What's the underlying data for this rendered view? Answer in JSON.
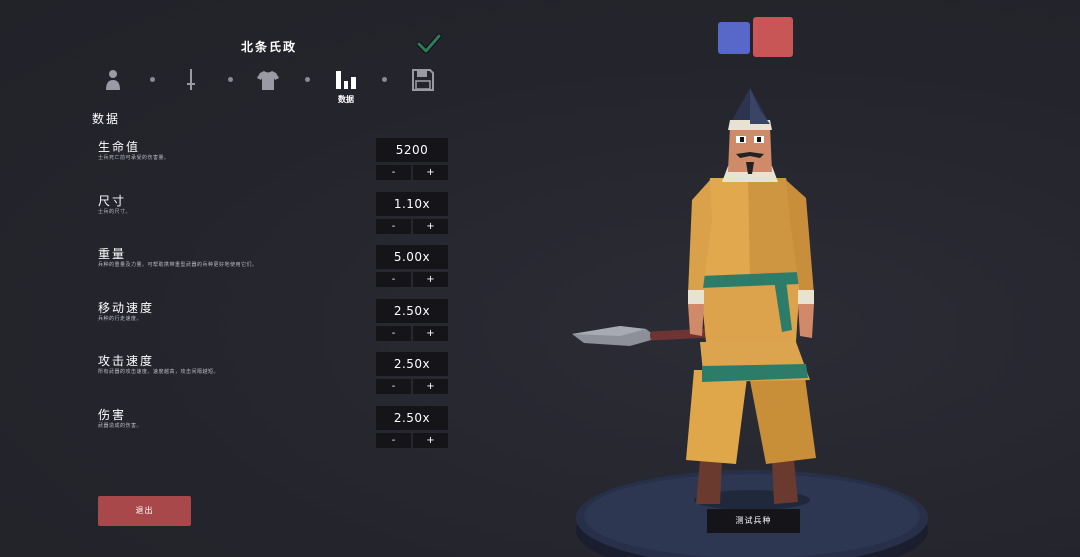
{
  "header": {
    "unit_name": "北条氏政"
  },
  "steps": {
    "items": [
      {
        "icon": "person-icon"
      },
      {
        "icon": "sword-icon"
      },
      {
        "icon": "shirt-icon"
      },
      {
        "icon": "bar-chart-icon",
        "label": "数据",
        "active": true
      },
      {
        "icon": "save-icon"
      }
    ]
  },
  "section": {
    "title": "数据"
  },
  "stats": [
    {
      "name": "生命值",
      "description": "士兵死亡前可承受的伤害量。",
      "value": "5200",
      "minus": "-",
      "plus": "+"
    },
    {
      "name": "尺寸",
      "description": "士兵的尺寸。",
      "value": "1.10x",
      "minus": "-",
      "plus": "+"
    },
    {
      "name": "重量",
      "description": "兵种的重量及力量。可帮助携带重型武器的兵种更好地使用它们。",
      "value": "5.00x",
      "minus": "-",
      "plus": "+"
    },
    {
      "name": "移动速度",
      "description": "兵种的行走速度。",
      "value": "2.50x",
      "minus": "-",
      "plus": "+"
    },
    {
      "name": "攻击速度",
      "description": "所有武器的攻击速度。速度越高，攻击间隔越短。",
      "value": "2.50x",
      "minus": "-",
      "plus": "+"
    },
    {
      "name": "伤害",
      "description": "武器造成的伤害。",
      "value": "2.50x",
      "minus": "-",
      "plus": "+"
    }
  ],
  "footer": {
    "exit_label": "退出",
    "test_label": "测试兵种"
  },
  "teams": {
    "blue_color": "#5868c8",
    "red_color": "#c85656"
  }
}
